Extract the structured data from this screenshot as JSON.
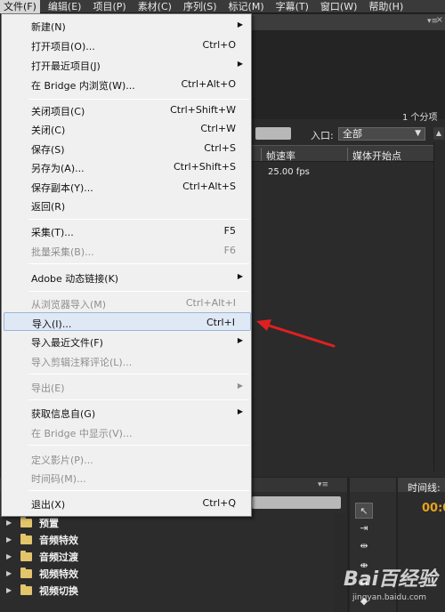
{
  "menubar": [
    {
      "label": "文件(F)",
      "active": true
    },
    {
      "label": "编辑(E)"
    },
    {
      "label": "项目(P)"
    },
    {
      "label": "素材(C)"
    },
    {
      "label": "序列(S)"
    },
    {
      "label": "标记(M)"
    },
    {
      "label": "字幕(T)"
    },
    {
      "label": "窗口(W)"
    },
    {
      "label": "帮助(H)"
    }
  ],
  "file_menu": {
    "new": {
      "label": "新建(N)"
    },
    "open_project": {
      "label": "打开项目(O)...",
      "shortcut": "Ctrl+O"
    },
    "open_recent": {
      "label": "打开最近项目(J)"
    },
    "browse_bridge": {
      "label": "在 Bridge 内浏览(W)...",
      "shortcut": "Ctrl+Alt+O"
    },
    "close_project": {
      "label": "关闭项目(C)",
      "shortcut": "Ctrl+Shift+W"
    },
    "close": {
      "label": "关闭(C)",
      "shortcut": "Ctrl+W"
    },
    "save": {
      "label": "保存(S)",
      "shortcut": "Ctrl+S"
    },
    "save_as": {
      "label": "另存为(A)...",
      "shortcut": "Ctrl+Shift+S"
    },
    "save_copy": {
      "label": "保存副本(Y)...",
      "shortcut": "Ctrl+Alt+S"
    },
    "revert": {
      "label": "返回(R)"
    },
    "capture": {
      "label": "采集(T)...",
      "shortcut": "F5"
    },
    "batch_capture": {
      "label": "批量采集(B)...",
      "shortcut": "F6"
    },
    "dynamic_link": {
      "label": "Adobe 动态链接(K)"
    },
    "import_browser": {
      "label": "从浏览器导入(M)",
      "shortcut": "Ctrl+Alt+I"
    },
    "import": {
      "label": "导入(I)...",
      "shortcut": "Ctrl+I"
    },
    "import_recent": {
      "label": "导入最近文件(F)"
    },
    "import_clip_notes": {
      "label": "导入剪辑注释评论(L)..."
    },
    "export": {
      "label": "导出(E)"
    },
    "get_properties": {
      "label": "获取信息自(G)"
    },
    "reveal_bridge": {
      "label": "在 Bridge 中显示(V)..."
    },
    "define_movie": {
      "label": "定义影片(P)..."
    },
    "timecode": {
      "label": "时间码(M)..."
    },
    "exit": {
      "label": "退出(X)",
      "shortcut": "Ctrl+Q"
    }
  },
  "project_panel": {
    "item_count": "1 个分项",
    "entry_label": "入口:",
    "entry_value": "全部",
    "columns": [
      "帧速率",
      "媒体开始点"
    ],
    "row_fps": "25.00 fps"
  },
  "effects_tree": [
    "预置",
    "音频特效",
    "音频过渡",
    "视频特效",
    "视频切换"
  ],
  "timeline": {
    "label": "时间线:",
    "timecode": "00:0"
  },
  "watermark": {
    "line1": "Bai百经验",
    "line2": "jingyan.baidu.com"
  },
  "colors": {
    "accent_arrow": "#e02020",
    "timecode": "#e7a21b",
    "menu_highlight": "#dfe8f5"
  }
}
